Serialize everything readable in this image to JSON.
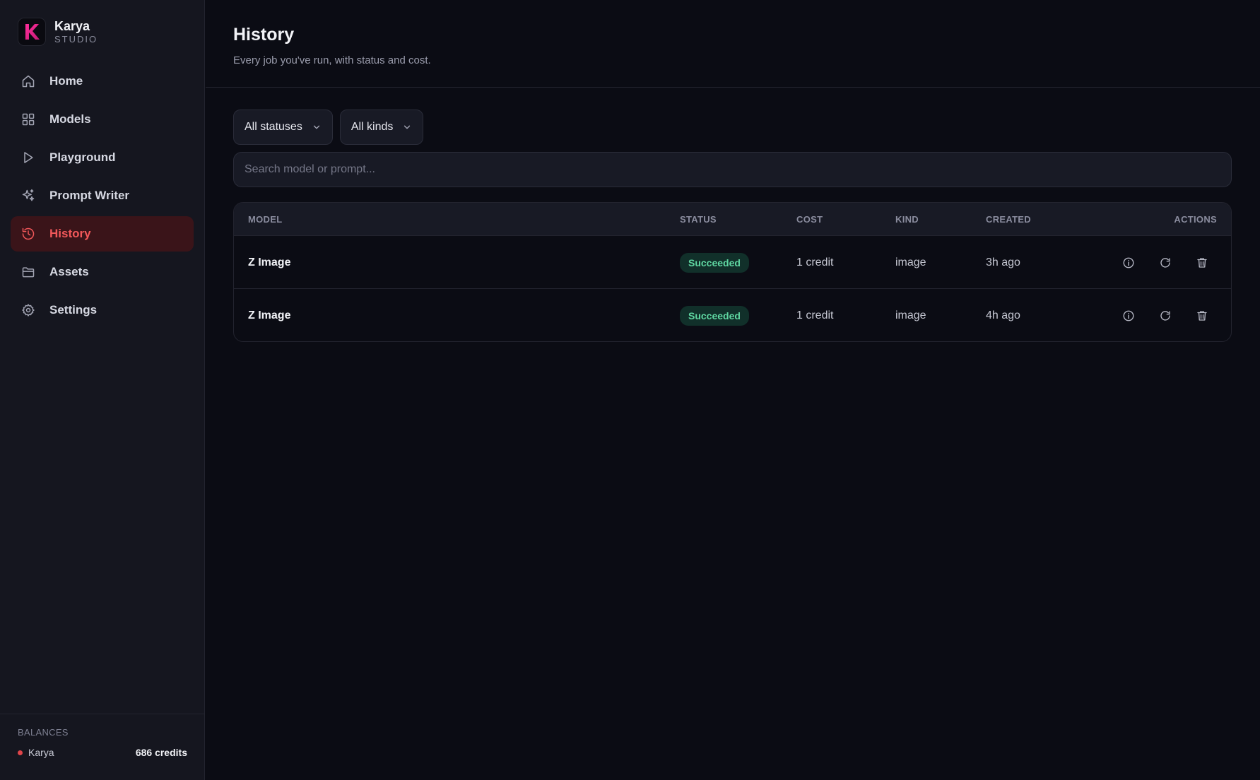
{
  "brand": {
    "name": "Karya",
    "sub": "STUDIO",
    "logo_letter": "K",
    "logo_color": "#e0208a"
  },
  "nav": [
    {
      "label": "Home",
      "icon": "home-icon",
      "active": false
    },
    {
      "label": "Models",
      "icon": "grid-icon",
      "active": false
    },
    {
      "label": "Playground",
      "icon": "play-icon",
      "active": false
    },
    {
      "label": "Prompt Writer",
      "icon": "sparkle-icon",
      "active": false
    },
    {
      "label": "History",
      "icon": "history-icon",
      "active": true
    },
    {
      "label": "Assets",
      "icon": "folder-icon",
      "active": false
    },
    {
      "label": "Settings",
      "icon": "gear-icon",
      "active": false
    }
  ],
  "balances": {
    "title": "BALANCES",
    "account": "Karya",
    "value": "686 credits"
  },
  "header": {
    "title": "History",
    "subtitle": "Every job you've run, with status and cost."
  },
  "filters": {
    "status": "All statuses",
    "kind": "All kinds"
  },
  "search": {
    "placeholder": "Search model or prompt..."
  },
  "table": {
    "columns": [
      "MODEL",
      "STATUS",
      "COST",
      "KIND",
      "CREATED",
      "ACTIONS"
    ],
    "rows": [
      {
        "model": "Z Image",
        "status": "Succeeded",
        "cost": "1 credit",
        "kind": "image",
        "created": "3h ago"
      },
      {
        "model": "Z Image",
        "status": "Succeeded",
        "cost": "1 credit",
        "kind": "image",
        "created": "4h ago"
      }
    ]
  },
  "colors": {
    "accent": "#f2585a",
    "success": "#5fd7a2",
    "background": "#0b0c14",
    "sidebar": "#15161f"
  }
}
